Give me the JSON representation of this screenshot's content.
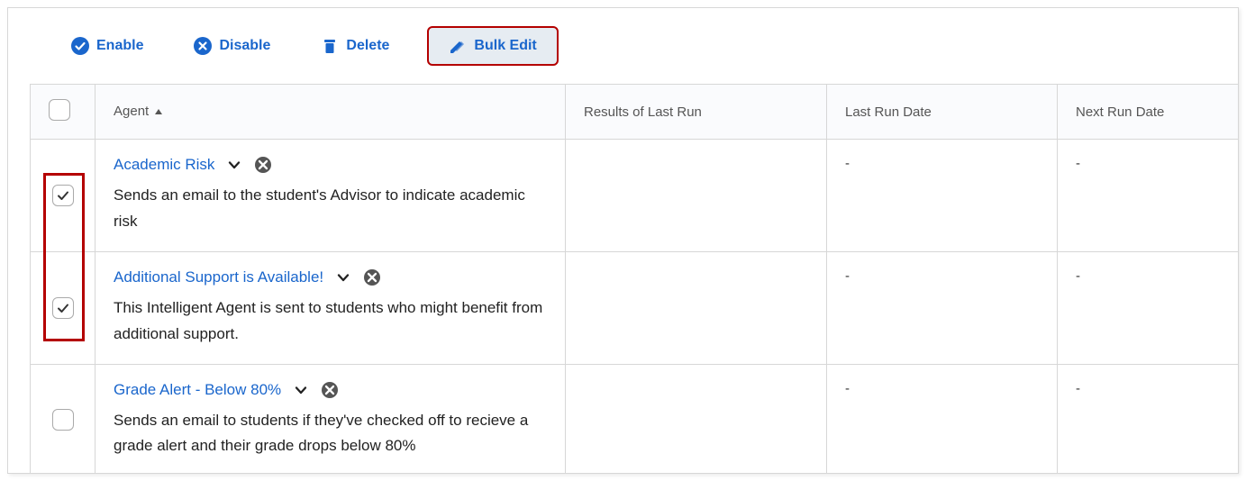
{
  "toolbar": {
    "enable": "Enable",
    "disable": "Disable",
    "delete": "Delete",
    "bulk_edit": "Bulk Edit"
  },
  "columns": {
    "agent": "Agent",
    "results": "Results of Last Run",
    "last_run": "Last Run Date",
    "next_run": "Next Run Date"
  },
  "rows": [
    {
      "checked": true,
      "title": "Academic Risk",
      "desc": "Sends an email to the student's Advisor to indicate academic risk",
      "results": "",
      "last_run": "-",
      "next_run": "-"
    },
    {
      "checked": true,
      "title": "Additional Support is Available!",
      "desc": "This Intelligent Agent is sent to students who might benefit from additional support.",
      "results": "",
      "last_run": "-",
      "next_run": "-"
    },
    {
      "checked": false,
      "title": "Grade Alert - Below 80%",
      "desc": "Sends an email to students if they've checked off to recieve a grade alert and their grade drops below 80%",
      "results": "",
      "last_run": "-",
      "next_run": "-"
    }
  ]
}
